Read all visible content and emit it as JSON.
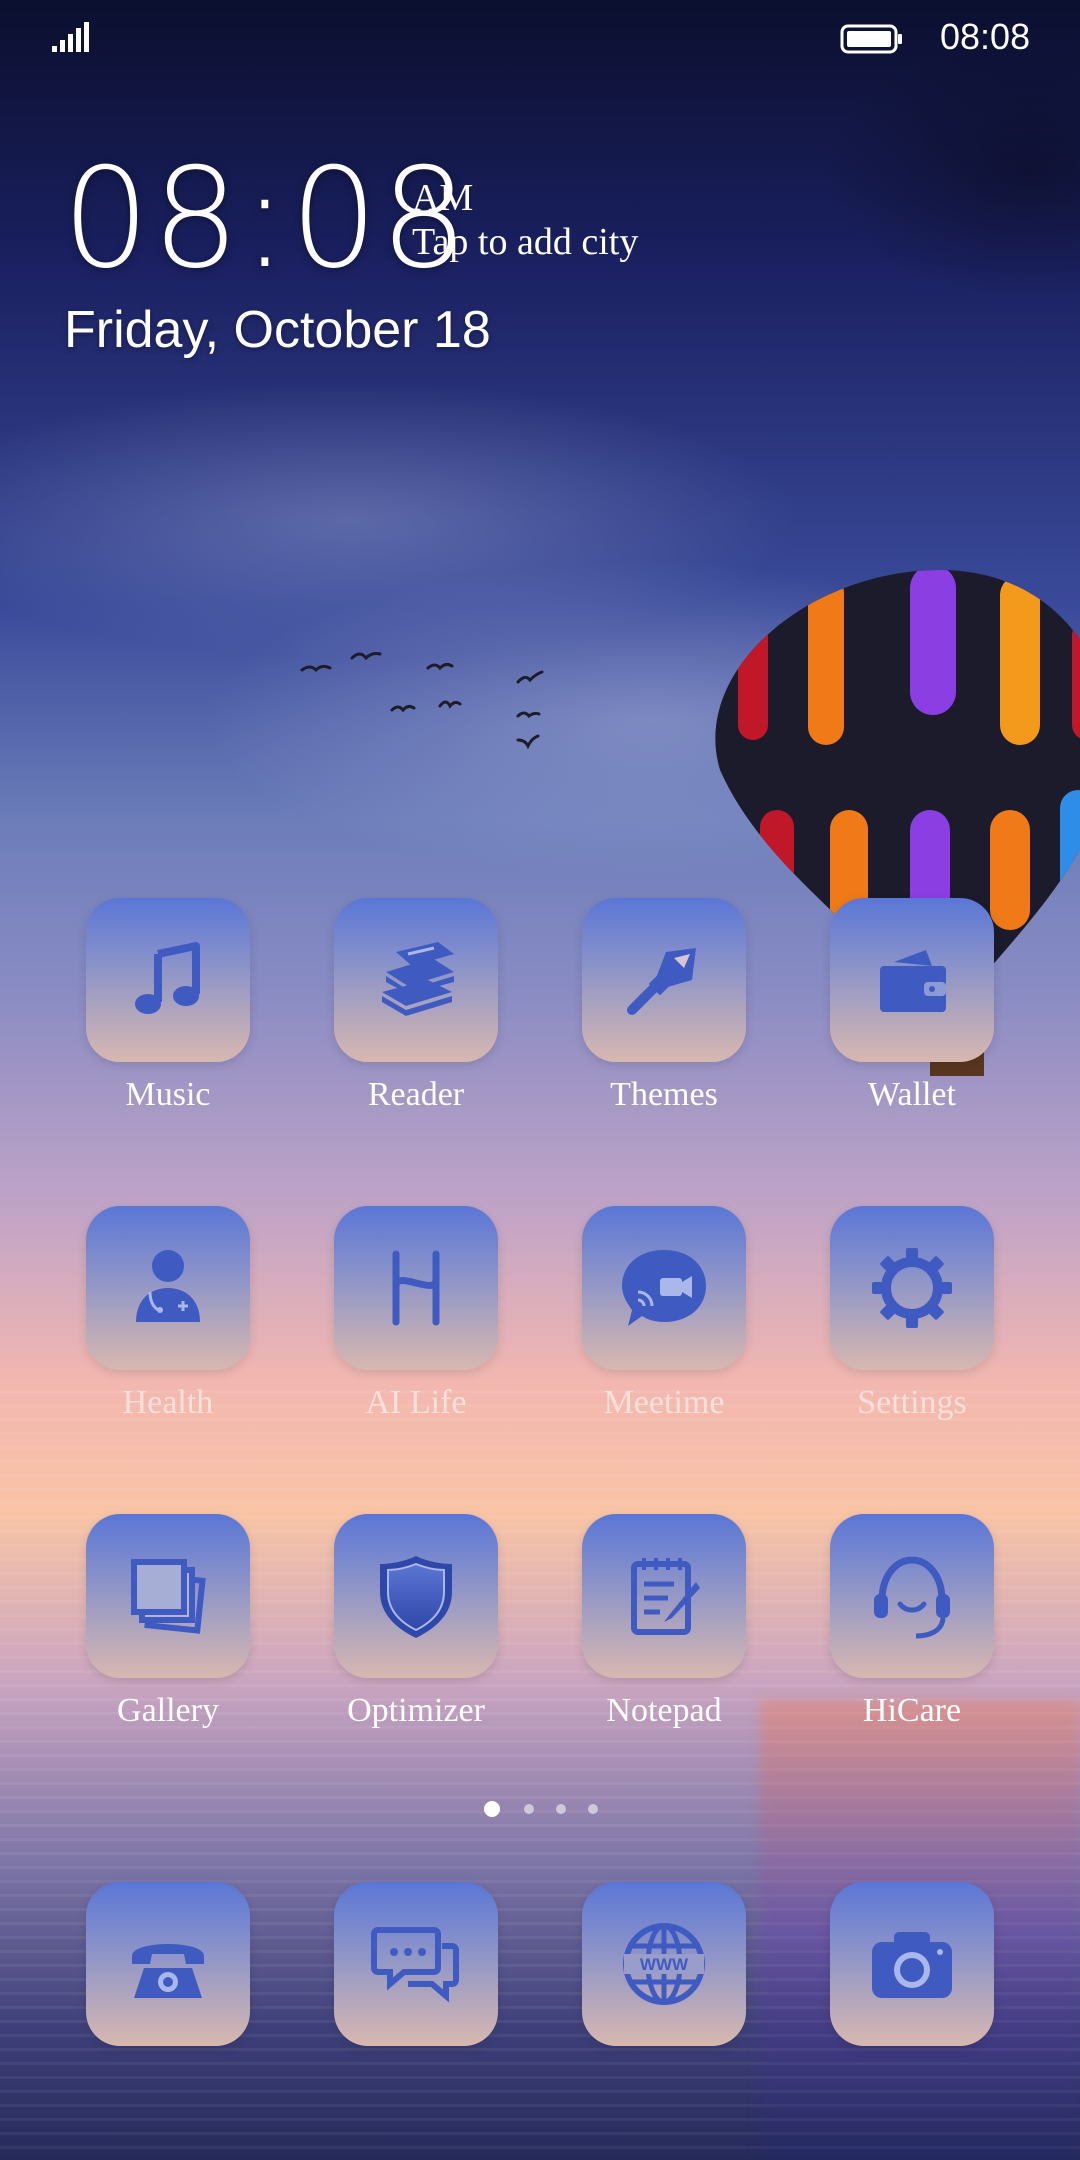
{
  "status_bar": {
    "time": "08:08",
    "signal_icon": "signal-bars-icon",
    "battery_icon": "battery-full-icon"
  },
  "clock_widget": {
    "time": "08:08",
    "ampm": "AM",
    "city_prompt": "Tap to add city",
    "date": "Friday, October 18"
  },
  "apps_row1": [
    {
      "label": "Music",
      "icon": "music-note-icon"
    },
    {
      "label": "Reader",
      "icon": "books-icon"
    },
    {
      "label": "Themes",
      "icon": "paintbrush-icon"
    },
    {
      "label": "Wallet",
      "icon": "wallet-icon"
    }
  ],
  "apps_row2": [
    {
      "label": "Health",
      "icon": "doctor-icon"
    },
    {
      "label": "AI Life",
      "icon": "ai-life-icon"
    },
    {
      "label": "Meetime",
      "icon": "video-chat-icon"
    },
    {
      "label": "Settings",
      "icon": "gear-icon"
    }
  ],
  "apps_row3": [
    {
      "label": "Gallery",
      "icon": "photos-icon"
    },
    {
      "label": "Optimizer",
      "icon": "shield-icon"
    },
    {
      "label": "Notepad",
      "icon": "notepad-icon"
    },
    {
      "label": "HiCare",
      "icon": "headset-icon"
    }
  ],
  "page_indicator": {
    "pages": 4,
    "current": 1
  },
  "dock": [
    {
      "icon": "phone-icon"
    },
    {
      "icon": "messages-icon"
    },
    {
      "icon": "browser-globe-icon"
    },
    {
      "icon": "camera-icon"
    }
  ],
  "colors": {
    "icon_fill": "#3f5bc2",
    "tile_top": "#5a76d6",
    "tile_bottom": "#d8b8b0"
  }
}
